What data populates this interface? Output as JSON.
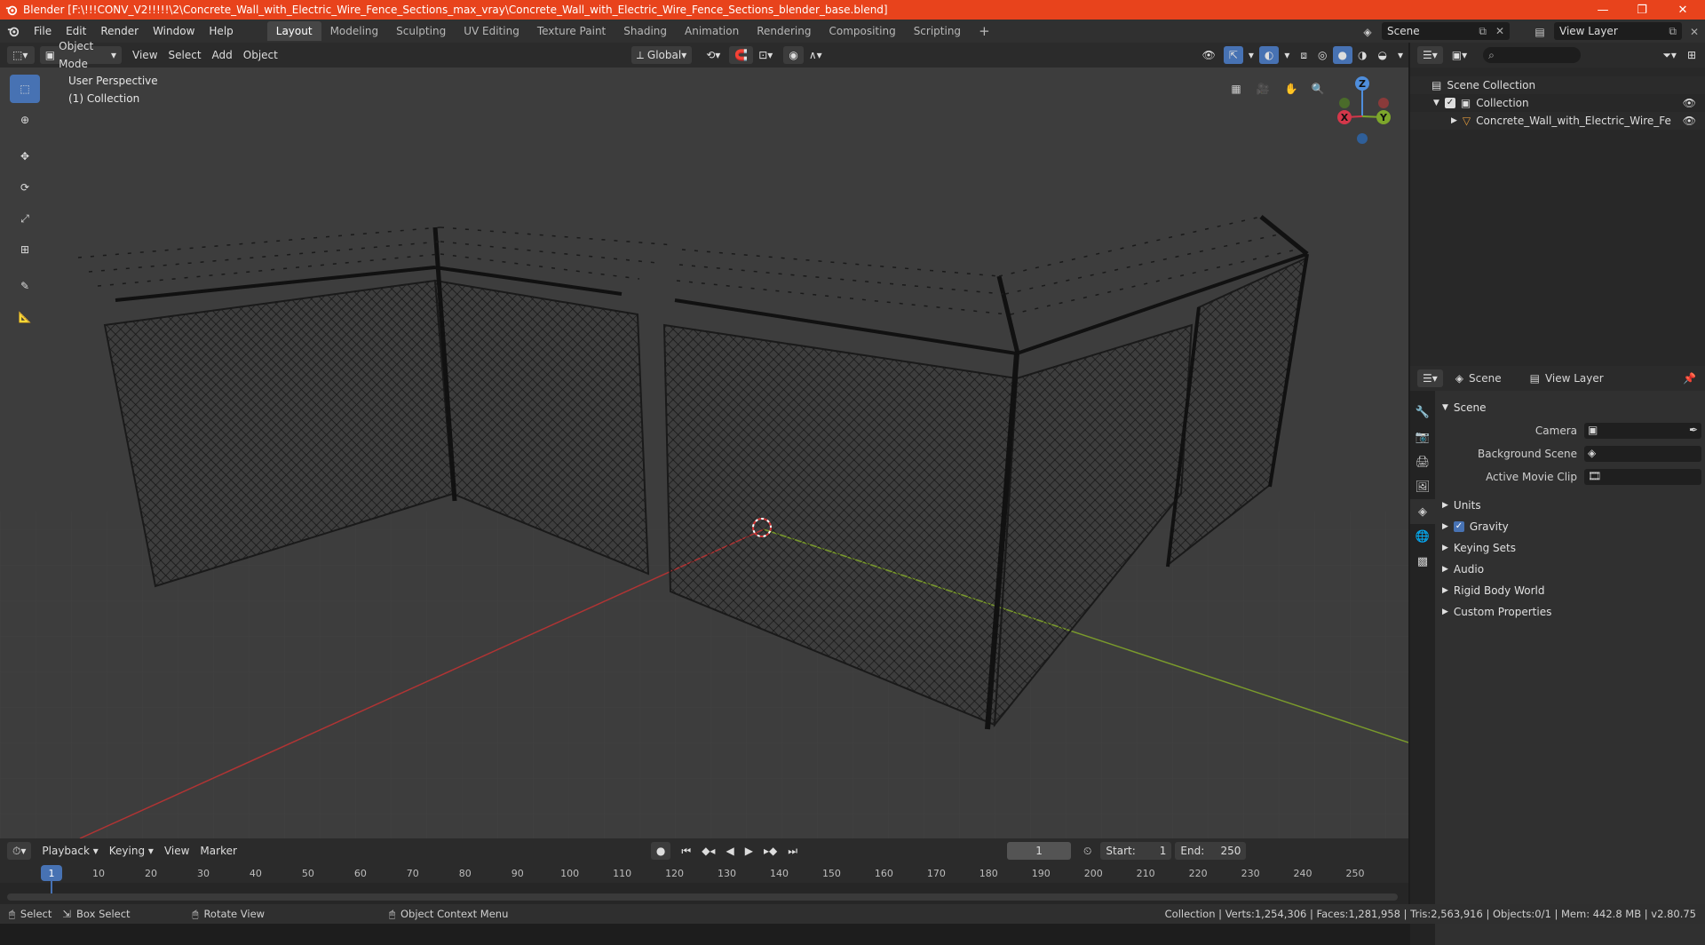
{
  "titlebar": {
    "title": "Blender [F:\\!!!CONV_V2!!!!!\\2\\Concrete_Wall_with_Electric_Wire_Fence_Sections_max_vray\\Concrete_Wall_with_Electric_Wire_Fence_Sections_blender_base.blend]",
    "color": "#e8431c"
  },
  "menu": {
    "items": [
      "File",
      "Edit",
      "Render",
      "Window",
      "Help"
    ]
  },
  "workspaces": {
    "tabs": [
      "Layout",
      "Modeling",
      "Sculpting",
      "UV Editing",
      "Texture Paint",
      "Shading",
      "Animation",
      "Rendering",
      "Compositing",
      "Scripting"
    ],
    "active": "Layout",
    "add": "+"
  },
  "scene_selector": {
    "value": "Scene"
  },
  "view_layer_selector": {
    "value": "View Layer"
  },
  "header3d": {
    "mode": "Object Mode",
    "view": "View",
    "select": "Select",
    "add": "Add",
    "object": "Object",
    "transform": "Global"
  },
  "viewport": {
    "perspective": "User Perspective",
    "collection": "(1) Collection",
    "gizmo": {
      "z": "Z",
      "y": "Y",
      "x": "X"
    },
    "colors": {
      "bg": "#3d3d3d",
      "x_axis": "#c0393a",
      "y_axis": "#7ca22c",
      "fence": "#141414",
      "cursor": "#d23636"
    }
  },
  "outliner": {
    "root": "Scene Collection",
    "collection": "Collection",
    "object": "Concrete_Wall_with_Electric_Wire_Fence_Se"
  },
  "properties": {
    "header_scene": "Scene",
    "header_view_layer": "View Layer",
    "section": "Scene",
    "camera_label": "Camera",
    "background_scene_label": "Background Scene",
    "active_movie_clip_label": "Active Movie Clip",
    "panels": [
      "Units",
      "Gravity",
      "Keying Sets",
      "Audio",
      "Rigid Body World",
      "Custom Properties"
    ]
  },
  "timeline": {
    "playback": "Playback",
    "keying": "Keying",
    "view": "View",
    "marker": "Marker",
    "current_frame": "1",
    "start_label": "Start:",
    "start_value": "1",
    "end_label": "End:",
    "end_value": "250",
    "ruler": [
      "1",
      "10",
      "20",
      "30",
      "40",
      "50",
      "60",
      "70",
      "80",
      "90",
      "100",
      "110",
      "120",
      "130",
      "140",
      "150",
      "160",
      "170",
      "180",
      "190",
      "200",
      "210",
      "220",
      "230",
      "240",
      "250"
    ],
    "ruler_frames": [
      1,
      10,
      20,
      30,
      40,
      50,
      60,
      70,
      80,
      90,
      100,
      110,
      120,
      130,
      140,
      150,
      160,
      170,
      180,
      190,
      200,
      210,
      220,
      230,
      240,
      250
    ]
  },
  "statusbar": {
    "select": "Select",
    "box_select": "Box Select",
    "rotate_view": "Rotate View",
    "context_menu": "Object Context Menu",
    "stats": "Collection | Verts:1,254,306 | Faces:1,281,958 | Tris:2,563,916 | Objects:0/1 | Mem: 442.8 MB | v2.80.75"
  }
}
